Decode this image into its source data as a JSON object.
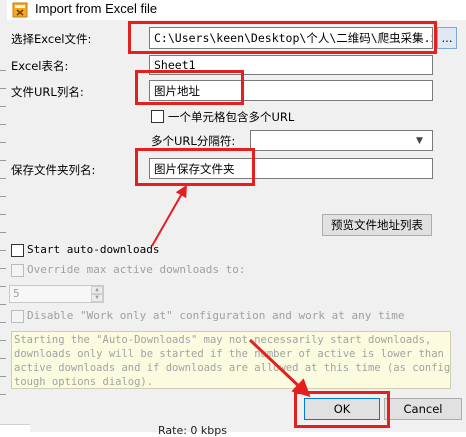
{
  "window": {
    "title": "Import from Excel file"
  },
  "form": {
    "excel_file_label": "选择Excel文件:",
    "excel_file_value": "C:\\Users\\keen\\Desktop\\个人\\二维码\\爬虫采集.xls",
    "browse_label": "...",
    "sheet_label": "Excel表名:",
    "sheet_value": "Sheet1",
    "url_column_label": "文件URL列名:",
    "url_column_value": "图片地址",
    "multi_url_label": "一个单元格包含多个URL",
    "separator_label": "多个URL分隔符:",
    "separator_value": "",
    "folder_column_label": "保存文件夹列名:",
    "folder_column_value": "图片保存文件夹",
    "preview_button": "预览文件地址列表"
  },
  "options": {
    "start_auto_downloads_label": "Start auto-downloads",
    "override_label": "Override max active downloads to:",
    "override_value": "5",
    "disable_work_only_label": "Disable \"Work only at\" configuration and work at any time",
    "notice_lines": [
      "Starting the \"Auto-Downloads\" may not necessarily start downloads,",
      "downloads only will be started if the number of active is lower than max",
      "active downloads and if downloads are allowed at this time (as configured",
      "tough options dialog)."
    ]
  },
  "buttons": {
    "ok": "OK",
    "cancel": "Cancel"
  },
  "background": {
    "rate_text": "Rate: 0 kbps"
  },
  "colors": {
    "annotation_red": "#e41f1f",
    "dialog_bg": "#f0f0f0",
    "notice_bg": "#fbfbe0"
  }
}
